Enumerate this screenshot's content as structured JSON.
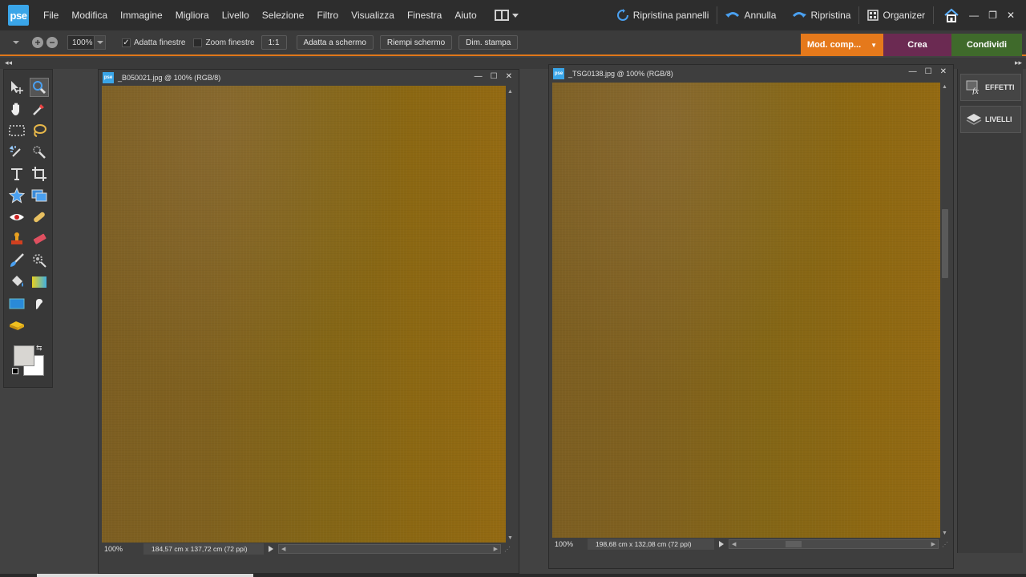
{
  "app": {
    "logo_text": "pse"
  },
  "menu": [
    "File",
    "Modifica",
    "Immagine",
    "Migliora",
    "Livello",
    "Selezione",
    "Filtro",
    "Visualizza",
    "Finestra",
    "Aiuto"
  ],
  "toolbar_top": {
    "reset_panels": "Ripristina pannelli",
    "undo": "Annulla",
    "redo": "Ripristina",
    "organizer": "Organizer"
  },
  "window_controls": {
    "minimize": "—",
    "restore": "❐",
    "close": "✕"
  },
  "options": {
    "zoom_value": "100%",
    "fit_windows_label": "Adatta finestre",
    "fit_windows_checked": true,
    "zoom_windows_label": "Zoom finestre",
    "zoom_windows_checked": false,
    "one_to_one": "1:1",
    "fit_screen": "Adatta a schermo",
    "fill_screen": "Riempi schermo",
    "print_size": "Dim. stampa"
  },
  "modes": {
    "edit": "Mod. comp...",
    "create": "Crea",
    "share": "Condividi",
    "colors": {
      "edit": "#e5791b",
      "create": "#6b2a52",
      "share": "#3f6a2b"
    }
  },
  "panels": {
    "effects": "EFFETTI",
    "layers": "LIVELLI"
  },
  "documents": [
    {
      "title": "_B050021.jpg @ 100% (RGB/8)",
      "zoom": "100%",
      "dimensions": "184,57 cm x 137,72 cm (72 ppi)"
    },
    {
      "title": "_TSG0138.jpg @ 100% (RGB/8)",
      "zoom": "100%",
      "dimensions": "198,68 cm x 132,08 cm (72 ppi)"
    }
  ],
  "swatches": {
    "foreground": "#d8d6d2",
    "background": "#ffffff"
  },
  "icons": {
    "tools": [
      "move-icon",
      "zoom-icon",
      "hand-icon",
      "eyedropper-icon",
      "rectangular-marquee-icon",
      "lasso-icon",
      "magic-wand-icon",
      "quick-selection-icon",
      "type-icon",
      "crop-icon",
      "cookie-cutter-icon",
      "recompose-icon",
      "red-eye-icon",
      "spot-healing-icon",
      "clone-stamp-icon",
      "eraser-icon",
      "brush-icon",
      "smart-brush-icon",
      "paint-bucket-icon",
      "gradient-icon",
      "shape-icon",
      "smudge-icon",
      "sponge-icon"
    ]
  }
}
